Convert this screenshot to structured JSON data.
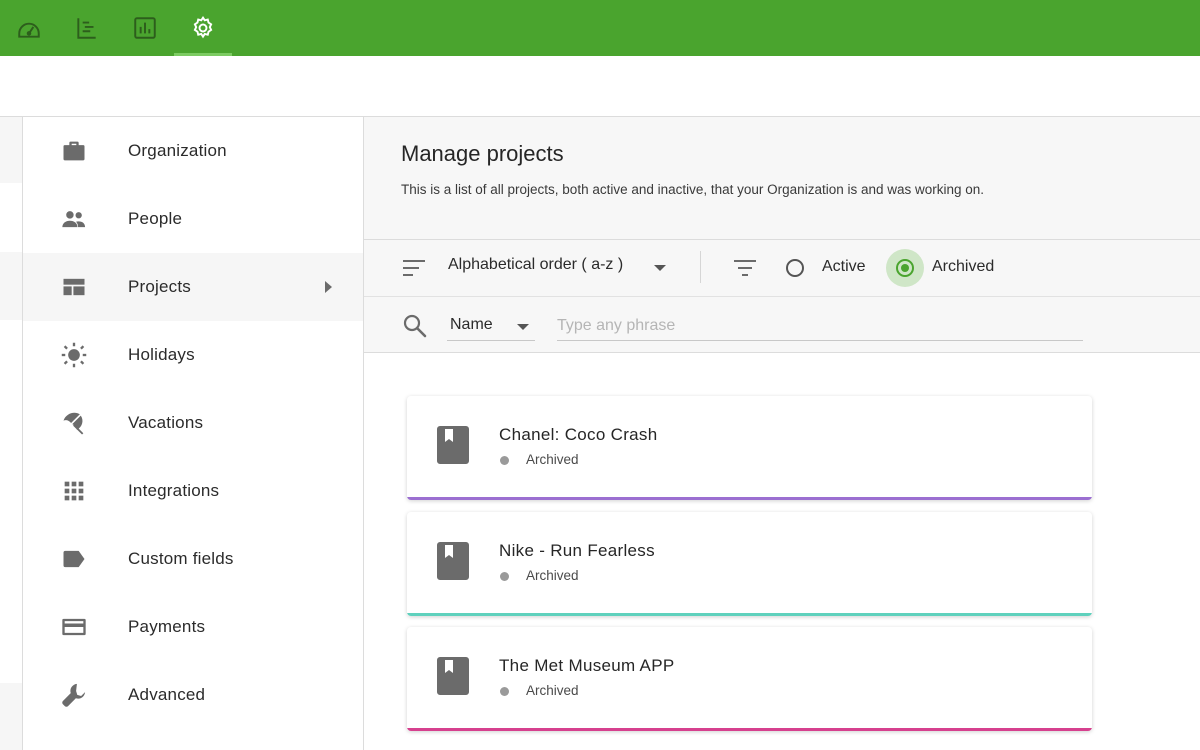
{
  "topnav": {
    "items": [
      {
        "name": "dashboard-icon",
        "active": false
      },
      {
        "name": "timeline-icon",
        "active": false
      },
      {
        "name": "reports-icon",
        "active": false
      },
      {
        "name": "settings-icon",
        "active": true
      }
    ],
    "bar_color": "#4aa42e"
  },
  "sidebar": {
    "items": [
      {
        "label": "Organization",
        "icon": "briefcase-icon"
      },
      {
        "label": "People",
        "icon": "people-icon"
      },
      {
        "label": "Projects",
        "icon": "projects-icon",
        "selected": true
      },
      {
        "label": "Holidays",
        "icon": "sun-icon"
      },
      {
        "label": "Vacations",
        "icon": "beach-umbrella-icon"
      },
      {
        "label": "Integrations",
        "icon": "grid-apps-icon"
      },
      {
        "label": "Custom fields",
        "icon": "label-tag-icon"
      },
      {
        "label": "Payments",
        "icon": "credit-card-icon"
      },
      {
        "label": "Advanced",
        "icon": "wrench-icon"
      }
    ]
  },
  "main": {
    "title": "Manage projects",
    "description": "This is a list of all projects, both active and inactive, that your Organization is and was working on.",
    "sort": {
      "value": "Alphabetical order ( a-z )"
    },
    "filter": {
      "options": [
        {
          "label": "Active",
          "selected": false
        },
        {
          "label": "Archived",
          "selected": true
        }
      ]
    },
    "search": {
      "field": "Name",
      "placeholder": "Type any phrase",
      "value": ""
    }
  },
  "projects": [
    {
      "name": "Chanel: Coco Crash",
      "status": "Archived",
      "color": "#9b6fd1"
    },
    {
      "name": "Nike - Run Fearless",
      "status": "Archived",
      "color": "#5fd1bd"
    },
    {
      "name": "The Met Museum APP",
      "status": "Archived",
      "color": "#d6408e"
    }
  ]
}
